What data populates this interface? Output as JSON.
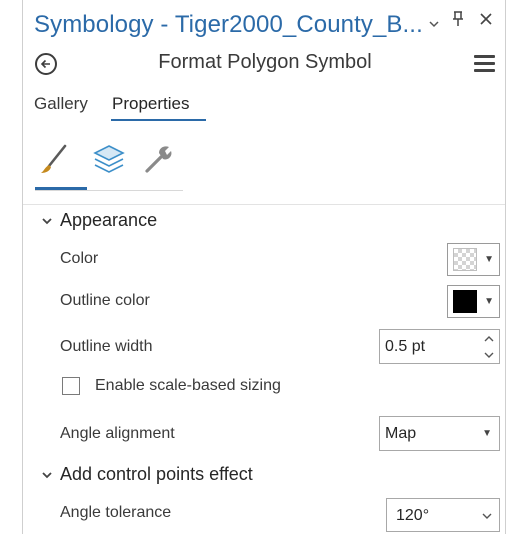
{
  "window": {
    "title": "Symbology - Tiger2000_County_B...",
    "controls": {
      "dropdown": "⌄",
      "pin": "ᵖ",
      "close": "✕"
    }
  },
  "header": {
    "subtitle": "Format Polygon Symbol"
  },
  "tabs": [
    {
      "label": "Gallery",
      "active": false
    },
    {
      "label": "Properties",
      "active": true
    }
  ],
  "symbol_tabs": [
    {
      "icon": "paintbrush-icon",
      "active": true
    },
    {
      "icon": "layers-icon",
      "active": false
    },
    {
      "icon": "wrench-icon",
      "active": false
    }
  ],
  "appearance": {
    "heading": "Appearance",
    "color_label": "Color",
    "outline_color_label": "Outline color",
    "outline_width_label": "Outline width",
    "outline_width_value": "0.5 pt",
    "scale_sizing_label": "Enable scale-based sizing",
    "scale_sizing_checked": false,
    "angle_alignment_label": "Angle alignment",
    "angle_alignment_value": "Map",
    "outline_color_hex": "#000000"
  },
  "control_points": {
    "heading": "Add control points effect",
    "angle_tolerance_label": "Angle tolerance",
    "angle_tolerance_value": "120°"
  },
  "colors": {
    "accent": "#2b6aa8"
  }
}
